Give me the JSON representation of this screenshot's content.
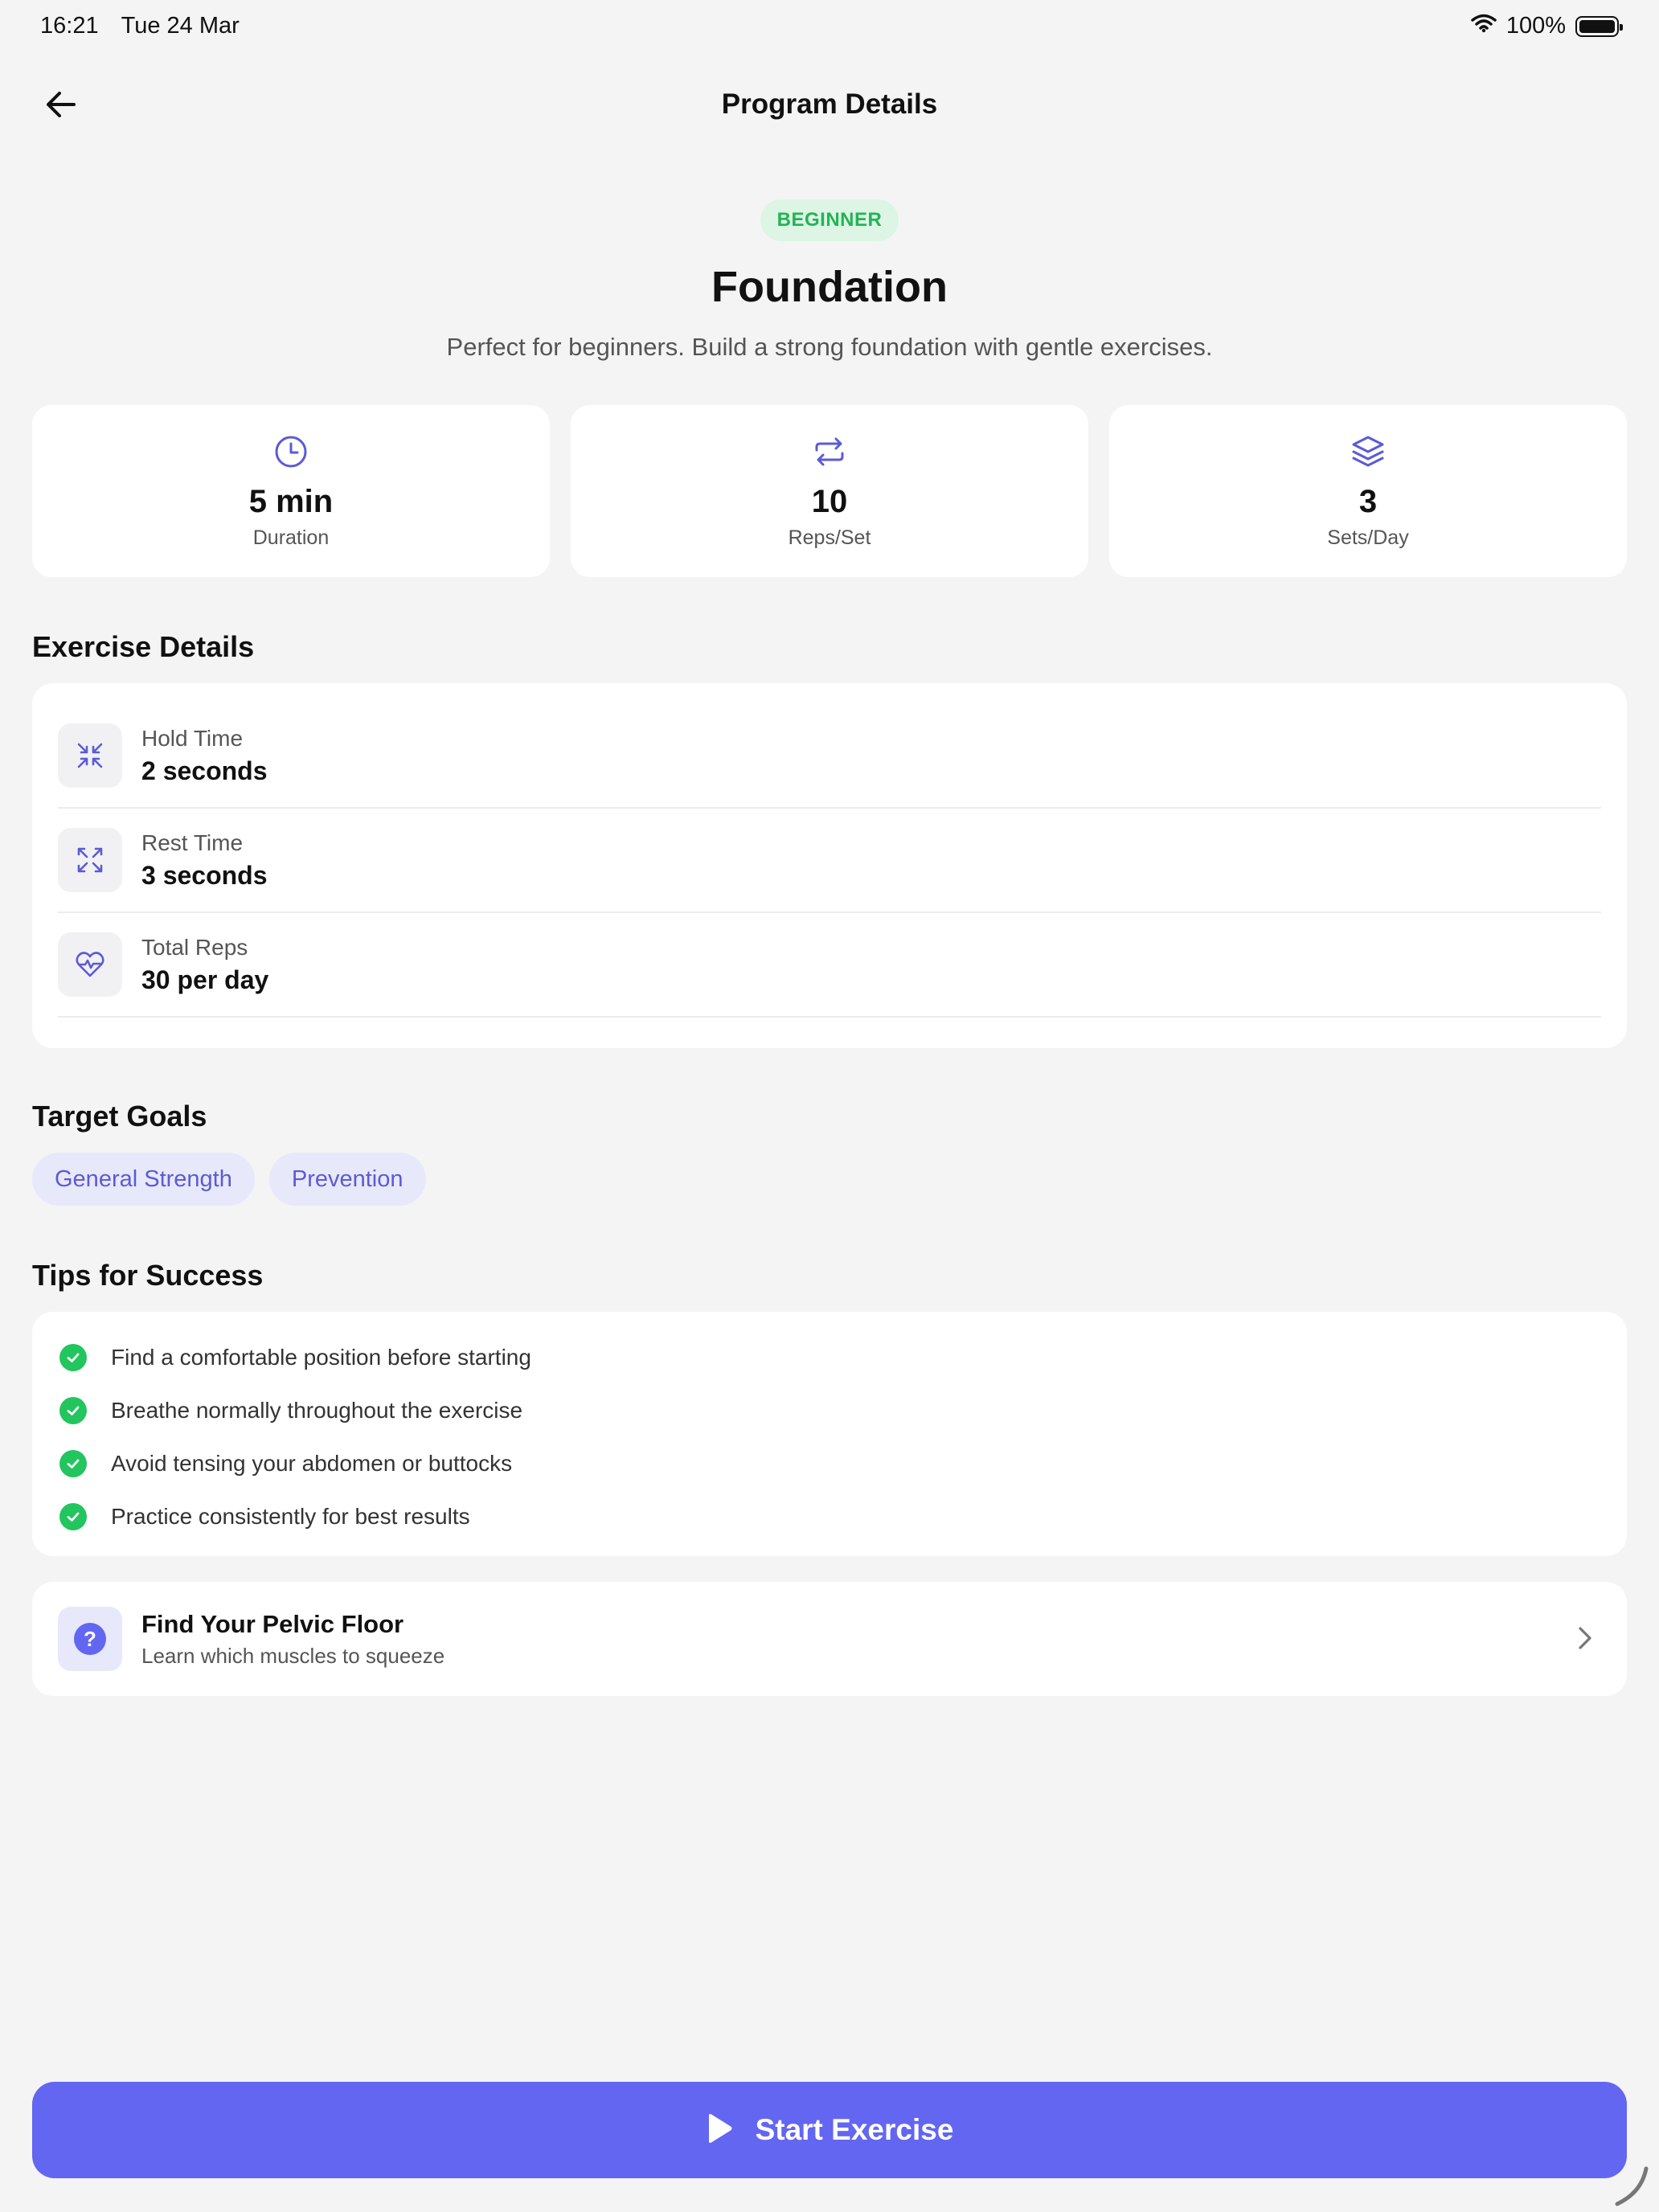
{
  "status_bar": {
    "time": "16:21",
    "date": "Tue 24 Mar",
    "battery": "100%",
    "icons": [
      "wifi-icon",
      "battery-icon"
    ]
  },
  "nav": {
    "back_icon": "arrow-left-icon",
    "title": "Program Details"
  },
  "program": {
    "level": "BEGINNER",
    "title": "Foundation",
    "description": "Perfect for beginners. Build a strong foundation with gentle exercises."
  },
  "stats": [
    {
      "icon": "clock-icon",
      "value": "5 min",
      "label": "Duration"
    },
    {
      "icon": "repeat-icon",
      "value": "10",
      "label": "Reps/Set"
    },
    {
      "icon": "layers-icon",
      "value": "3",
      "label": "Sets/Day"
    }
  ],
  "exercise_details": {
    "title": "Exercise Details",
    "rows": [
      {
        "icon": "shrink-arrows-icon",
        "label": "Hold Time",
        "value": "2 seconds"
      },
      {
        "icon": "expand-arrows-icon",
        "label": "Rest Time",
        "value": "3 seconds"
      },
      {
        "icon": "heart-pulse-icon",
        "label": "Total Reps",
        "value": "30 per day"
      }
    ]
  },
  "target_goals": {
    "title": "Target Goals",
    "goals": [
      "General Strength",
      "Prevention"
    ]
  },
  "tips": {
    "title": "Tips for Success",
    "items": [
      "Find a comfortable position before starting",
      "Breathe normally throughout the exercise",
      "Avoid tensing your abdomen or buttocks",
      "Practice consistently for best results"
    ]
  },
  "pelvic_link": {
    "icon": "question-circle-icon",
    "title": "Find Your Pelvic Floor",
    "subtitle": "Learn which muscles to squeeze"
  },
  "start_button": {
    "icon": "play-icon",
    "label": "Start Exercise"
  },
  "colors": {
    "accent": "#6366f1",
    "success": "#22c55e",
    "badge_bg": "#dcf5e5",
    "chip_bg": "#e8e8fb",
    "background": "#f4f4f5"
  }
}
